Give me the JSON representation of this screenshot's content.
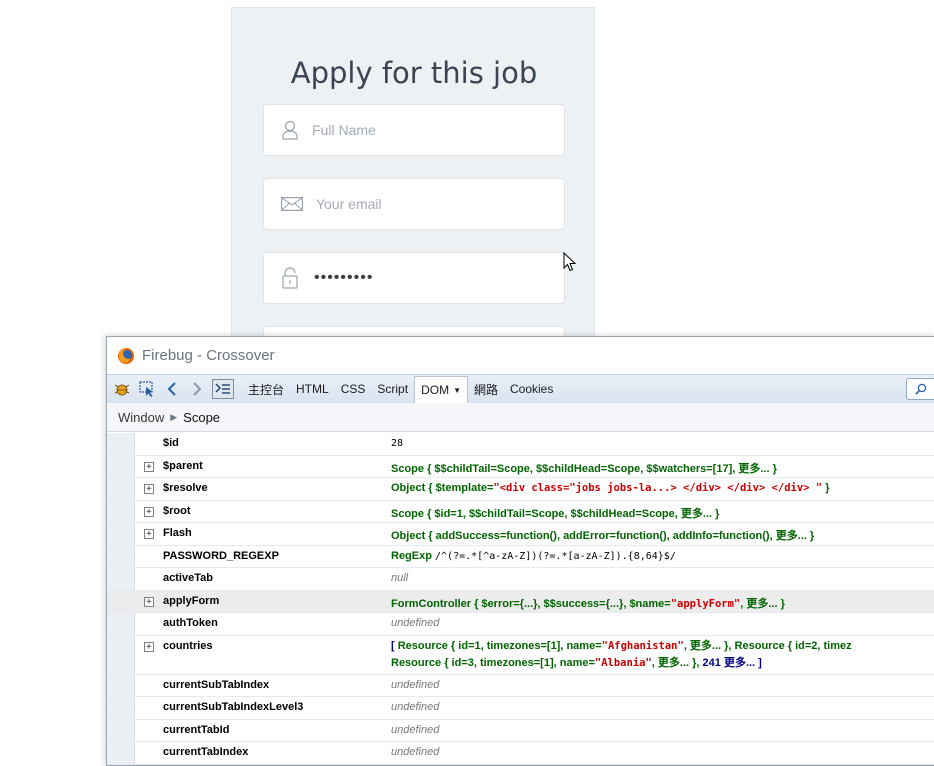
{
  "form": {
    "title": "Apply for this job",
    "name_placeholder": "Full Name",
    "email_placeholder": "Your email",
    "password_value": "•••••••••"
  },
  "firebug": {
    "window_title": "Firebug - Crossover",
    "tabs": [
      "主控台",
      "HTML",
      "CSS",
      "Script",
      "DOM",
      "網路",
      "Cookies"
    ],
    "active_tab": "DOM",
    "breadcrumb": [
      "Window",
      "Scope"
    ],
    "rows": [
      {
        "name": "$id",
        "expandable": false,
        "value": "28",
        "kind": "num"
      },
      {
        "name": "$parent",
        "expandable": true,
        "value": "Scope { $$childTail=Scope, $$childHead=Scope, $$watchers=[17], 更多... }",
        "kind": "obj"
      },
      {
        "name": "$resolve",
        "expandable": true,
        "value": "Object { $template=",
        "value_str": "\"<div class=\"jobs jobs-la...> </div> </div> </div> \"",
        "value_end": " }",
        "kind": "objstr"
      },
      {
        "name": "$root",
        "expandable": true,
        "value": "Scope { $id=1, $$childTail=Scope, $$childHead=Scope, 更多... }",
        "kind": "obj"
      },
      {
        "name": "Flash",
        "expandable": true,
        "value": "Object { addSuccess=function(), addError=function(), addInfo=function(), 更多... }",
        "kind": "obj"
      },
      {
        "name": "PASSWORD_REGEXP",
        "expandable": false,
        "value": "RegExp ",
        "value_str": "/^(?=.*[^a-zA-Z])(?=.*[a-zA-Z]).{8,64}$/",
        "kind": "regex"
      },
      {
        "name": "activeTab",
        "expandable": false,
        "value": "null",
        "kind": "null"
      },
      {
        "name": "applyForm",
        "expandable": true,
        "value": "FormController { $error={...}, $$success={...}, $name=",
        "value_str": "\"applyForm\"",
        "value_end": ", 更多... }",
        "kind": "objstr"
      },
      {
        "name": "authToken",
        "expandable": false,
        "value": "undefined",
        "kind": "null"
      },
      {
        "name": "countries",
        "expandable": true,
        "kind": "arr",
        "line1": [
          "[ ",
          "Resource { id=1, timezones=[1], name=",
          "\"Afghanistan\"",
          ", 更多... }, ",
          "Resource { id=2, timez"
        ],
        "line2": [
          "Resource { id=3, timezones=[1], name=",
          "\"Albania\"",
          ", 更多... }, ",
          "241 更多... ]"
        ]
      },
      {
        "name": "currentSubTabIndex",
        "expandable": false,
        "value": "undefined",
        "kind": "null"
      },
      {
        "name": "currentSubTabIndexLevel3",
        "expandable": false,
        "value": "undefined",
        "kind": "null"
      },
      {
        "name": "currentTabId",
        "expandable": false,
        "value": "undefined",
        "kind": "null"
      },
      {
        "name": "currentTabIndex",
        "expandable": false,
        "value": "undefined",
        "kind": "null"
      }
    ]
  },
  "colors": {
    "object_green": "#006400",
    "string_red": "#cc0000",
    "array_blue": "#000080"
  }
}
